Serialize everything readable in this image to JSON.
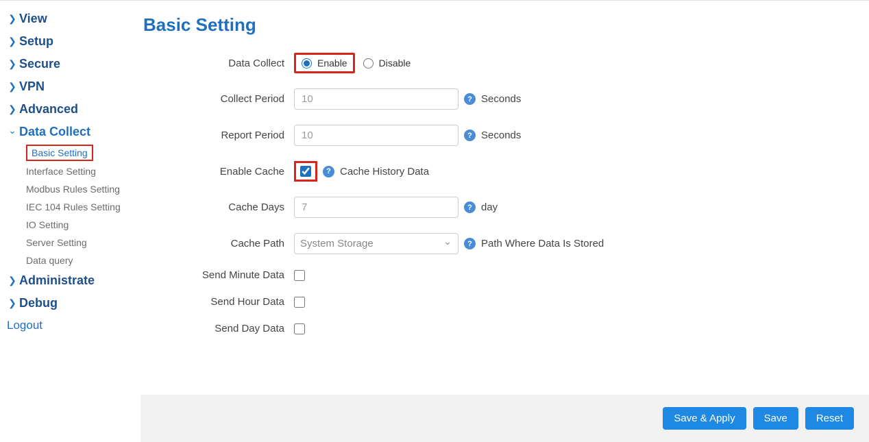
{
  "sidebar": {
    "items": [
      {
        "label": "View",
        "expanded": false
      },
      {
        "label": "Setup",
        "expanded": false
      },
      {
        "label": "Secure",
        "expanded": false
      },
      {
        "label": "VPN",
        "expanded": false
      },
      {
        "label": "Advanced",
        "expanded": false
      },
      {
        "label": "Data Collect",
        "expanded": true
      },
      {
        "label": "Administrate",
        "expanded": false
      },
      {
        "label": "Debug",
        "expanded": false
      }
    ],
    "data_collect_sub": [
      "Basic Setting",
      "Interface Setting",
      "Modbus Rules Setting",
      "IEC 104 Rules Setting",
      "IO Setting",
      "Server Setting",
      "Data query"
    ],
    "logout": "Logout"
  },
  "page": {
    "title": "Basic Setting"
  },
  "form": {
    "data_collect": {
      "label": "Data Collect",
      "enable": "Enable",
      "disable": "Disable",
      "value": "enable"
    },
    "collect_period": {
      "label": "Collect Period",
      "value": "10",
      "unit": "Seconds"
    },
    "report_period": {
      "label": "Report Period",
      "value": "10",
      "unit": "Seconds"
    },
    "enable_cache": {
      "label": "Enable Cache",
      "checked": true,
      "hint": "Cache History Data"
    },
    "cache_days": {
      "label": "Cache Days",
      "value": "7",
      "unit": "day"
    },
    "cache_path": {
      "label": "Cache Path",
      "value": "System Storage",
      "hint": "Path Where Data Is Stored"
    },
    "send_minute": {
      "label": "Send Minute Data",
      "checked": false
    },
    "send_hour": {
      "label": "Send Hour Data",
      "checked": false
    },
    "send_day": {
      "label": "Send Day Data",
      "checked": false
    }
  },
  "buttons": {
    "save_apply": "Save & Apply",
    "save": "Save",
    "reset": "Reset"
  },
  "colors": {
    "primary": "#1e70bf",
    "highlight": "#d9261c",
    "button": "#1e88e5"
  }
}
